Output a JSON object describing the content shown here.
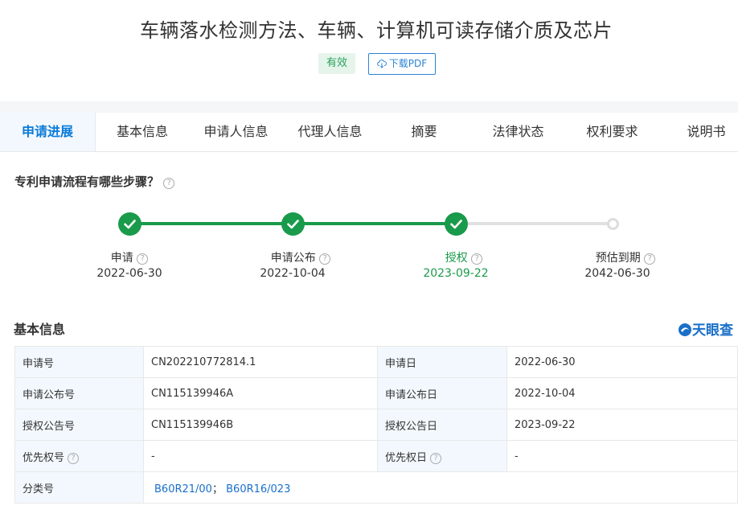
{
  "header": {
    "title": "车辆落水检测方法、车辆、计算机可读存储介质及芯片",
    "status": "有效",
    "download_label": "下载PDF"
  },
  "tabs": [
    "申请进展",
    "基本信息",
    "申请人信息",
    "代理人信息",
    "摘要",
    "法律状态",
    "权利要求",
    "说明书"
  ],
  "progress": {
    "question": "专利申请流程有哪些步骤？",
    "steps": [
      {
        "label": "申请",
        "date": "2022-06-30",
        "done": true
      },
      {
        "label": "申请公布",
        "date": "2022-10-04",
        "done": true
      },
      {
        "label": "授权",
        "date": "2023-09-22",
        "done": true,
        "current": true
      },
      {
        "label": "预估到期",
        "date": "2042-06-30",
        "done": false
      }
    ]
  },
  "basic": {
    "title": "基本信息",
    "brand": "天眼查",
    "rows": [
      {
        "k1": "申请号",
        "v1": "CN202210772814.1",
        "k2": "申请日",
        "v2": "2022-06-30"
      },
      {
        "k1": "申请公布号",
        "v1": "CN115139946A",
        "k2": "申请公布日",
        "v2": "2022-10-04"
      },
      {
        "k1": "授权公告号",
        "v1": "CN115139946B",
        "k2": "授权公告日",
        "v2": "2023-09-22"
      },
      {
        "k1": "优先权号",
        "v1": "-",
        "k2": "优先权日",
        "v2": "-"
      }
    ],
    "class_label": "分类号",
    "class_codes": [
      "B60R21/00",
      "B60R16/023"
    ],
    "class_sep": "；"
  },
  "colors": {
    "accent": "#0a7bd8",
    "green": "#1a9a4b"
  }
}
